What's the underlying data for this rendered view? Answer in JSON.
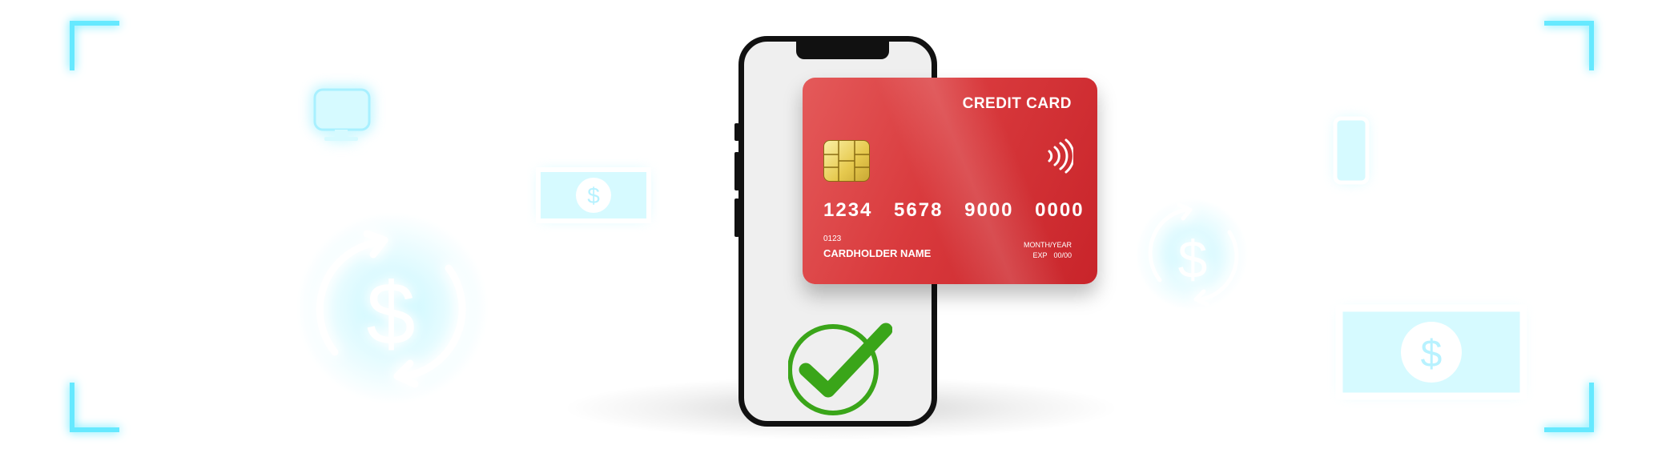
{
  "card": {
    "title": "CREDIT CARD",
    "number": "1234 5678 9000 0000",
    "code": "0123",
    "holder": "CARDHOLDER NAME",
    "month_year": "MONTH/YEAR",
    "exp_label": "EXP",
    "exp_value": "00/00"
  },
  "colors": {
    "card_red": "#d93a3d",
    "check_green": "#3aa519",
    "glow_cyan": "#66e9ff"
  },
  "icons": [
    "monitor-icon",
    "banknote-icon",
    "currency-exchange-icon",
    "smartphone-icon",
    "checkmark-icon",
    "nfc-icon",
    "chip-icon"
  ]
}
